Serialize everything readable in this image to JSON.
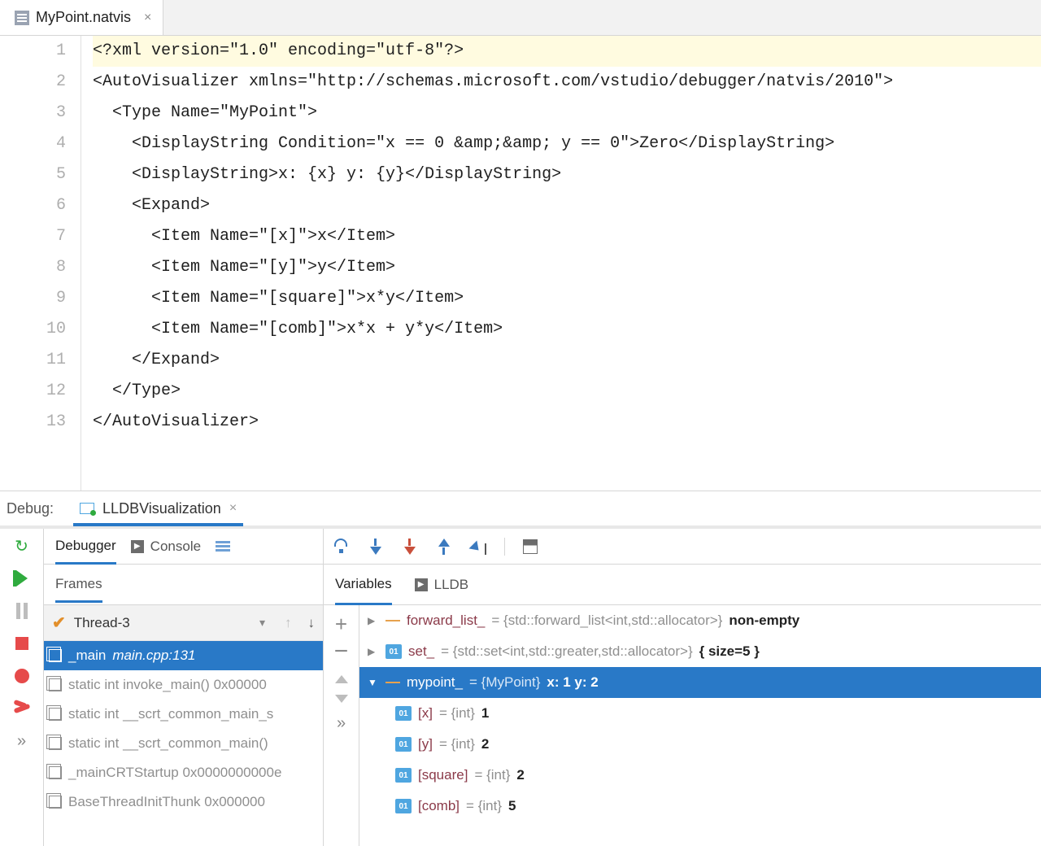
{
  "file_tab": {
    "name": "MyPoint.natvis"
  },
  "editor": {
    "lines": [
      "<?xml version=\"1.0\" encoding=\"utf-8\"?>",
      "<AutoVisualizer xmlns=\"http://schemas.microsoft.com/vstudio/debugger/natvis/2010\">",
      "  <Type Name=\"MyPoint\">",
      "    <DisplayString Condition=\"x == 0 &amp;&amp; y == 0\">Zero</DisplayString>",
      "    <DisplayString>x: {x} y: {y}</DisplayString>",
      "    <Expand>",
      "      <Item Name=\"[x]\">x</Item>",
      "      <Item Name=\"[y]\">y</Item>",
      "      <Item Name=\"[square]\">x*y</Item>",
      "      <Item Name=\"[comb]\">x*x + y*y</Item>",
      "    </Expand>",
      "  </Type>",
      "</AutoVisualizer>"
    ]
  },
  "debug": {
    "label": "Debug:",
    "run_config": "LLDBVisualization",
    "tabs": {
      "debugger": "Debugger",
      "console": "Console"
    },
    "frames_label": "Frames",
    "thread": "Thread-3",
    "frames": [
      {
        "name": "_main",
        "loc": "main.cpp:131",
        "selected": true
      },
      {
        "name": "static int invoke_main() 0x00000"
      },
      {
        "name": "static int __scrt_common_main_s"
      },
      {
        "name": "static int __scrt_common_main()"
      },
      {
        "name": "_mainCRTStartup 0x0000000000e"
      },
      {
        "name": "BaseThreadInitThunk 0x000000"
      }
    ],
    "var_tabs": {
      "variables": "Variables",
      "lldb": "LLDB"
    },
    "vars": {
      "forward_list": {
        "name": "forward_list_",
        "type": "{std::forward_list<int,std::allocator>}",
        "val": "non-empty"
      },
      "set": {
        "name": "set_",
        "type": "{std::set<int,std::greater,std::allocator>}",
        "val": "{ size=5 }"
      },
      "mypoint": {
        "name": "mypoint_",
        "type": "{MyPoint}",
        "val": "x: 1 y: 2"
      },
      "children": [
        {
          "name": "[x]",
          "type": "{int}",
          "val": "1"
        },
        {
          "name": "[y]",
          "type": "{int}",
          "val": "2"
        },
        {
          "name": "[square]",
          "type": "{int}",
          "val": "2"
        },
        {
          "name": "[comb]",
          "type": "{int}",
          "val": "5"
        }
      ]
    }
  }
}
